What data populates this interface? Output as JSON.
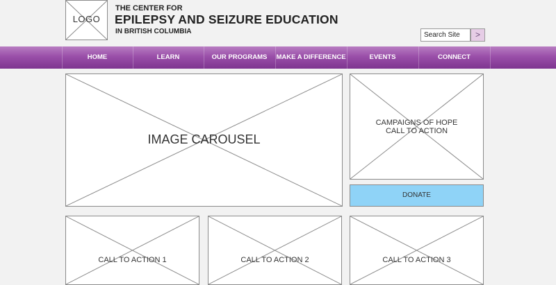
{
  "header": {
    "logo_label": "LOGO",
    "title_line1": "THE CENTER FOR",
    "title_line2": "EPILEPSY AND SEIZURE EDUCATION",
    "title_line3": "IN BRITISH COLUMBIA"
  },
  "search": {
    "placeholder": "Search Site",
    "button_label": ">"
  },
  "nav": {
    "items": [
      {
        "label": "HOME"
      },
      {
        "label": "LEARN"
      },
      {
        "label": "OUR PROGRAMS"
      },
      {
        "label": "MAKE A DIFFERENCE"
      },
      {
        "label": "EVENTS"
      },
      {
        "label": "CONNECT"
      }
    ]
  },
  "main": {
    "carousel_label": "IMAGE CAROUSEL",
    "campaign_line1": "CAMPAIGNS OF HOPE",
    "campaign_line2": "CALL TO ACTION",
    "donate_label": "DONATE",
    "cta": [
      {
        "label": "CALL TO ACTION 1"
      },
      {
        "label": "CALL TO ACTION 2"
      },
      {
        "label": "CALL TO ACTION 3"
      }
    ]
  },
  "colors": {
    "nav_purple": "#9a4fa9",
    "donate_blue": "#8fd3f7",
    "search_button": "#e6cde6"
  }
}
